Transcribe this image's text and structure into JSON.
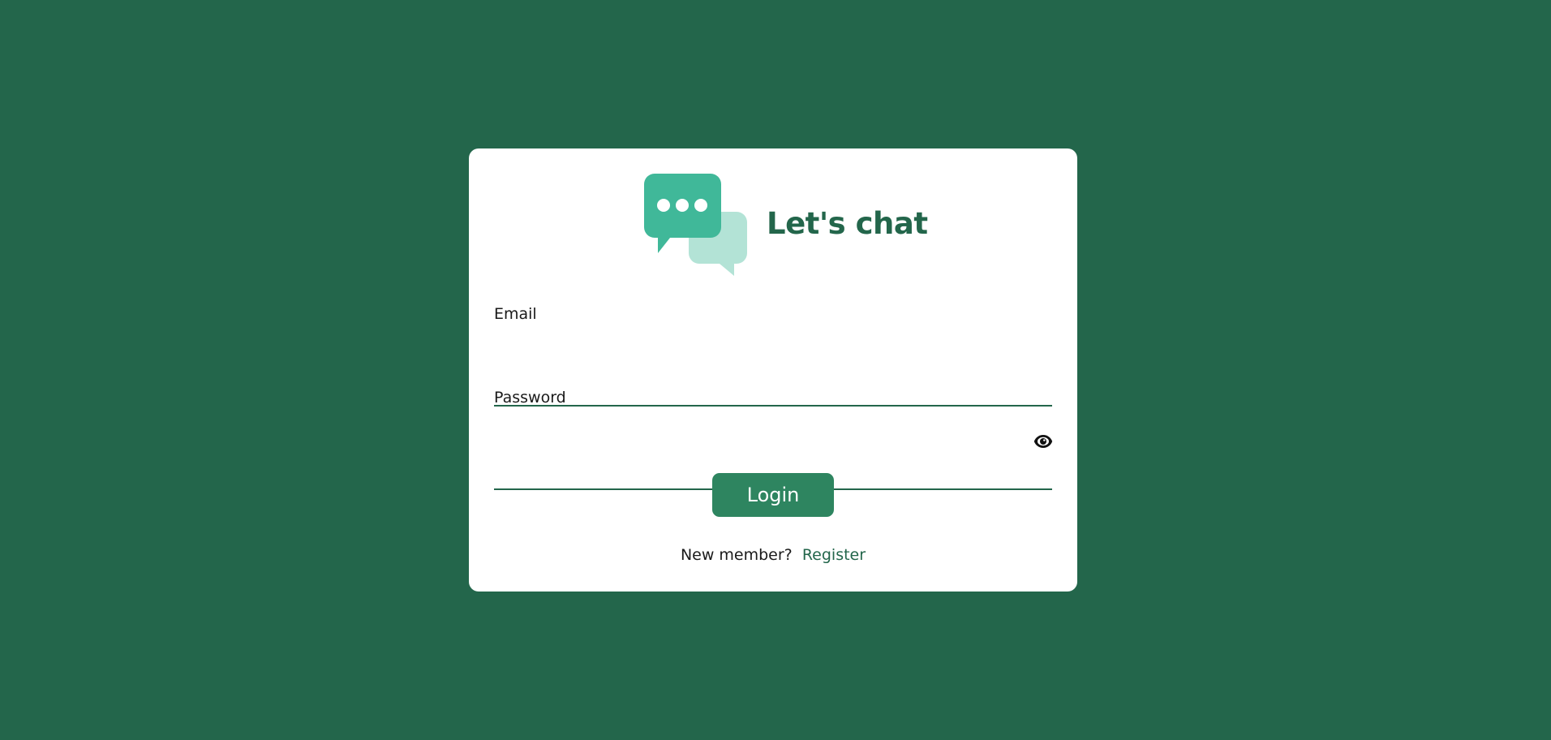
{
  "brand": {
    "title": "Let's chat",
    "logo_icon": "chat-bubbles-icon"
  },
  "form": {
    "email": {
      "label": "Email",
      "value": "",
      "placeholder": ""
    },
    "password": {
      "label": "Password",
      "value": "",
      "placeholder": "",
      "toggle_icon": "eye-icon"
    },
    "login_label": "Login"
  },
  "register": {
    "prompt": "New member?",
    "link_label": "Register"
  },
  "colors": {
    "background": "#23664b",
    "card": "#ffffff",
    "accent": "#23664b",
    "button": "#2e8560",
    "bubble_primary": "#40b899",
    "bubble_secondary": "#b3e3d6"
  }
}
